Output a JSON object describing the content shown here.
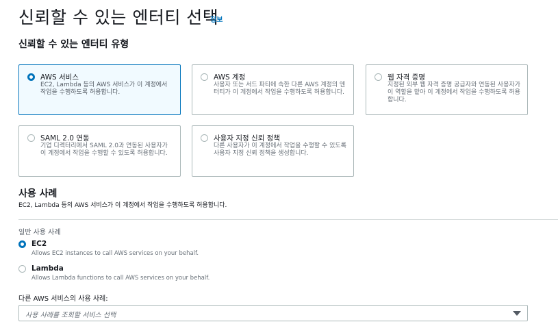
{
  "header": {
    "title": "신뢰할 수 있는 엔터티 선택",
    "info_link": "정보"
  },
  "entity_type": {
    "title": "신뢰할 수 있는 엔터티 유형",
    "options": [
      {
        "title": "AWS 서비스",
        "description": "EC2, Lambda 등의 AWS 서비스가 이 계정에서 작업을 수행하도록 허용합니다.",
        "selected": true
      },
      {
        "title": "AWS 계정",
        "description": "사용자 또는 서드 파티에 속한 다른 AWS 계정의 엔터티가 이 계정에서 작업을 수행하도록 허용합니다.",
        "selected": false
      },
      {
        "title": "웹 자격 증명",
        "description": "지정된 외부 웹 자격 증명 공급자와 연동된 사용자가 이 역할을 맡아 이 계정에서 작업을 수행하도록 허용합니다.",
        "selected": false
      },
      {
        "title": "SAML 2.0 연동",
        "description": "기업 디렉터리에서 SAML 2.0과 연동된 사용자가 이 계정에서 작업을 수행할 수 있도록 허용합니다.",
        "selected": false
      },
      {
        "title": "사용자 지정 신뢰 정책",
        "description": "다른 사용자가 이 계정에서 작업을 수행할 수 있도록 사용자 지정 신뢰 정책을 생성합니다.",
        "selected": false
      }
    ]
  },
  "use_case": {
    "title": "사용 사례",
    "description": "EC2, Lambda 등의 AWS 서비스가 이 계정에서 작업을 수행하도록 허용합니다.",
    "common_label": "일반 사용 사례",
    "options": [
      {
        "title": "EC2",
        "description": "Allows EC2 instances to call AWS services on your behalf.",
        "selected": true
      },
      {
        "title": "Lambda",
        "description": "Allows Lambda functions to call AWS services on your behalf.",
        "selected": false
      }
    ],
    "other_label": "다른 AWS 서비스의 사용 사례:",
    "select_placeholder": "사용 사례를 조회할 서비스 선택"
  },
  "colors": {
    "accent": "#0073bb",
    "selected_tile_bg": "#f1faff",
    "border": "#aab7b8"
  }
}
